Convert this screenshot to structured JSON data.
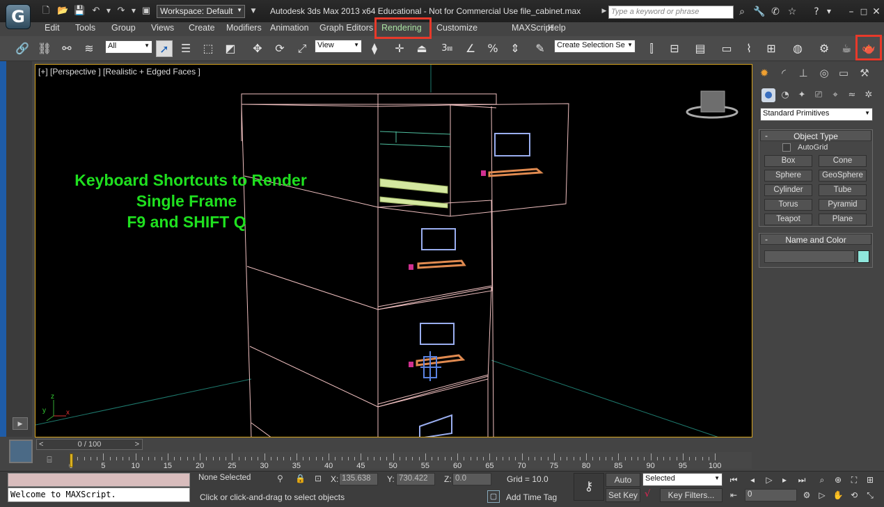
{
  "window": {
    "title": "Autodesk 3ds Max  2013 x64   Educational - Not for Commercial Use   file_cabinet.max",
    "workspace": "Workspace: Default",
    "search_placeholder": "Type a keyword or phrase",
    "app_logo_glyph": "G"
  },
  "menu": [
    "Edit",
    "Tools",
    "Group",
    "Views",
    "Create",
    "Modifiers",
    "Animation",
    "Graph Editors",
    "Rendering",
    "Customize",
    "MAXScript",
    "Help"
  ],
  "highlight_color": "#e8392a",
  "toolbar": {
    "selection_filter": "All",
    "ref_coord": "View",
    "named_selection": "Create Selection Se",
    "snap_label": "3"
  },
  "viewport": {
    "label": "[+] [Perspective ] [Realistic + Edged Faces ]",
    "overlay_lines": [
      "Keyboard Shortcuts to Render",
      "Single Frame",
      "F9 and SHIFT Q"
    ],
    "overlay_color": "#1fe01f",
    "axis_labels": {
      "x": "x",
      "y": "y",
      "z": "z"
    }
  },
  "command_panel": {
    "category": "Standard Primitives",
    "object_type_title": "Object Type",
    "autogrid_label": "AutoGrid",
    "object_buttons": [
      "Box",
      "Cone",
      "Sphere",
      "GeoSphere",
      "Cylinder",
      "Tube",
      "Torus",
      "Pyramid",
      "Teapot",
      "Plane"
    ],
    "name_color_title": "Name and Color",
    "name_value": "",
    "swatch_color": "#8fe6dc",
    "rollout_minus": "-"
  },
  "timeline": {
    "slider_label": "0 / 100",
    "prev": "<",
    "next": ">",
    "ticks": [
      0,
      5,
      10,
      15,
      20,
      25,
      30,
      35,
      40,
      45,
      50,
      55,
      60,
      65,
      70,
      75,
      80,
      85,
      90,
      95,
      100
    ],
    "current_frame": 0
  },
  "status": {
    "maxscript_output": "Welcome to MAXScript.",
    "selection": "None Selected",
    "prompt": "Click or click-and-drag to select objects",
    "x_label": "X:",
    "x_value": "135.638",
    "y_label": "Y:",
    "y_value": "730.422",
    "z_label": "Z:",
    "z_value": "0.0",
    "grid": "Grid = 10.0",
    "add_time_tag": "Add Time Tag",
    "auto_key": "Auto Key",
    "set_key": "Set Key",
    "key_mode": "Selected",
    "key_filters": "Key Filters...",
    "frame_field": "0"
  }
}
